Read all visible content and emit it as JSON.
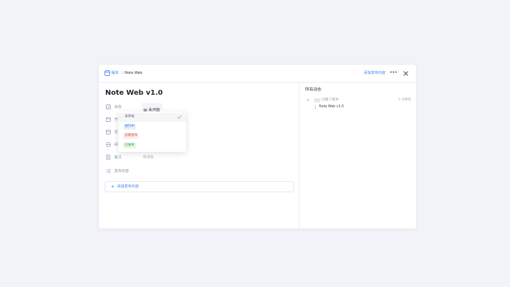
{
  "header": {
    "breadcrumb_root": "版本",
    "breadcrumb_sep": "/",
    "breadcrumb_current": "Note Web",
    "add_release_label": "添加发布内容",
    "more_label": "•••"
  },
  "main": {
    "title": "Note Web v1.0",
    "fields": [
      {
        "label": "状态",
        "icon": "checkbox-icon"
      },
      {
        "label": "开",
        "icon": "calendar-icon"
      },
      {
        "label": "发",
        "icon": "calendar-icon"
      },
      {
        "label": "阅",
        "icon": "progress-icon"
      },
      {
        "label": "备注",
        "value": "待添加",
        "icon": "note-icon"
      },
      {
        "label": "发布内容",
        "icon": "list-icon"
      }
    ],
    "status_value": "未开始",
    "add_content_label": "添加发布内容"
  },
  "status_dropdown": {
    "options": [
      {
        "label": "未开始",
        "selected": true,
        "color": "#4b5563",
        "bg": "transparent"
      },
      {
        "label": "进行中",
        "selected": false,
        "color": "#2f6fe4",
        "bg": "#e8f0fe"
      },
      {
        "label": "延期发布",
        "selected": false,
        "color": "#d9534f",
        "bg": "#fdecec"
      },
      {
        "label": "已发布",
        "selected": false,
        "color": "#3f8f3a",
        "bg": "#e9f6e6"
      }
    ]
  },
  "activity": {
    "title": "所有动态",
    "entries": [
      {
        "action": "创建了版本",
        "time": "2 分钟前",
        "item": "Note Web v1.0"
      }
    ]
  },
  "colors": {
    "accent": "#3d7bf2",
    "background": "#f2f3f8"
  }
}
